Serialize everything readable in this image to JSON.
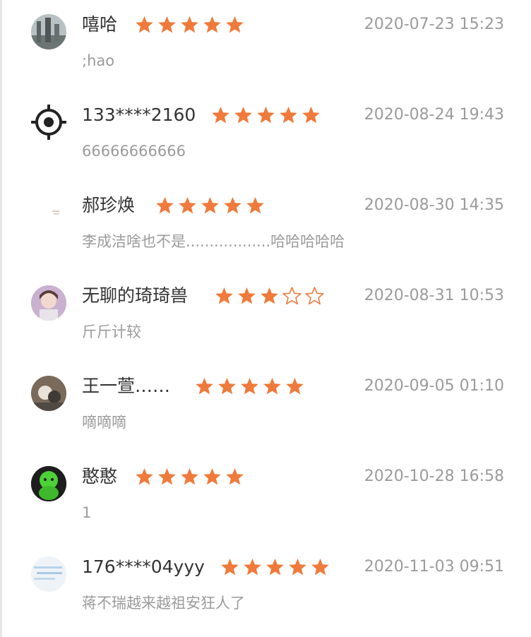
{
  "colors": {
    "star": "#ef7a3b",
    "name": "#333333",
    "meta": "#9b9b9b"
  },
  "reviews": [
    {
      "name": "嘻哈",
      "rating": 5,
      "time": "2020-07-23 15:23",
      "comment": ";hao",
      "avatar": "building-photo-avatar"
    },
    {
      "name": "133****2160",
      "rating": 5,
      "time": "2020-08-24 19:43",
      "comment": "66666666666",
      "avatar": "crosshair-avatar"
    },
    {
      "name": "郝珍焕",
      "rating": 5,
      "time": "2020-08-30 14:35",
      "comment": "李成洁啥也不是..................哈哈哈哈哈",
      "avatar": "blank-avatar"
    },
    {
      "name": "无聊的琦琦兽",
      "rating": 3,
      "time": "2020-08-31 10:53",
      "comment": "斤斤计较",
      "avatar": "girl-photo-avatar"
    },
    {
      "name": "王一萱……",
      "rating": 5,
      "time": "2020-09-05 01:10",
      "comment": "嘀嘀嘀",
      "avatar": "animal-photo-avatar"
    },
    {
      "name": "憨憨",
      "rating": 5,
      "time": "2020-10-28 16:58",
      "comment": "1",
      "avatar": "green-turtle-avatar"
    },
    {
      "name": "176****04yyy",
      "rating": 5,
      "time": "2020-11-03 09:51",
      "comment": "蒋不瑞越来越祖安狂人了",
      "avatar": "blue-lines-avatar"
    }
  ]
}
